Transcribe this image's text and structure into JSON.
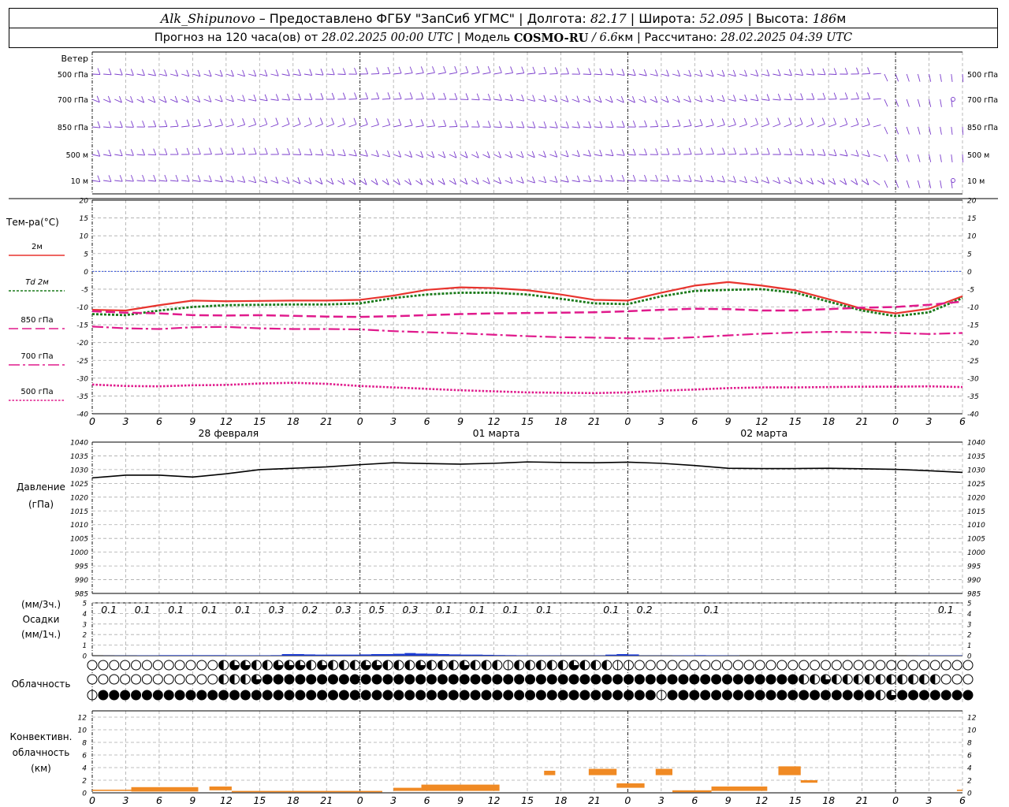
{
  "header": {
    "station": "Alk_Shipunovo",
    "provider": " – Предоставлено ФГБУ \"ЗапСиб УГМС\" | Долгота: ",
    "lon": "82.17",
    "lat_label": " | Широта: ",
    "lat": "52.095",
    "alt_label": " | Высота: ",
    "alt": "186",
    "alt_unit": "м",
    "forecast_prefix": "Прогноз на 120 часа(ов) от ",
    "base_time": "28.02.2025 00:00 UTC",
    "model_prefix": " | Модель ",
    "model": "COSMO-RU",
    "resolution": " / 6.6",
    "res_unit": "км",
    "calc_prefix": " | Рассчитано: ",
    "calc_time": "28.02.2025 04:39 UTC"
  },
  "chart_data": [
    {
      "type": "line",
      "panel": "wind",
      "ylabel": "Ветер",
      "levels": [
        "500 гПа",
        "700 гПа",
        "850 гПа",
        "500 м",
        "10  м"
      ],
      "calm_levels_at_end": [
        1,
        4
      ],
      "color": "#7a3ccc"
    },
    {
      "type": "line",
      "panel": "temperature",
      "ylabel": "Тем-ра(°C)",
      "ylim": [
        -40,
        20
      ],
      "yticks": [
        20,
        15,
        10,
        5,
        0,
        -5,
        -10,
        -15,
        -20,
        -25,
        -30,
        -35,
        -40
      ],
      "x_hours": [
        0,
        3,
        6,
        9,
        12,
        15,
        18,
        21,
        24,
        27,
        30,
        33,
        36,
        39,
        42,
        45,
        48,
        51,
        54,
        57,
        60,
        63,
        66,
        69,
        72,
        75,
        78
      ],
      "xtick_labels": [
        "0",
        "3",
        "6",
        "9",
        "12",
        "15",
        "18",
        "21",
        "0",
        "3",
        "6",
        "9",
        "12",
        "15",
        "18",
        "21",
        "0",
        "3",
        "6",
        "9",
        "12",
        "15",
        "18",
        "21",
        "0",
        "3",
        "6"
      ],
      "date_labels": [
        "28 февраля",
        "01 марта",
        "02 марта"
      ],
      "series": [
        {
          "name": "2м",
          "color": "#e8342e",
          "style": "solid",
          "values": [
            -10.8,
            -11,
            -9.5,
            -8.2,
            -8.4,
            -8.3,
            -8.2,
            -8.2,
            -8,
            -6.8,
            -5.2,
            -4.5,
            -4.7,
            -5.3,
            -6.5,
            -8,
            -8.2,
            -6,
            -4,
            -3,
            -4,
            -5.3,
            -7.8,
            -10.5,
            -11.8,
            -10.5,
            -7
          ]
        },
        {
          "name": "Td  2м",
          "color": "#1a7a1a",
          "style": "dotted",
          "values": [
            -12,
            -12.3,
            -11,
            -10,
            -9.5,
            -9.4,
            -9.3,
            -9.3,
            -9,
            -7.5,
            -6.5,
            -6,
            -6,
            -6.5,
            -7.7,
            -9,
            -9.2,
            -7,
            -5.5,
            -5.2,
            -5,
            -6,
            -8.5,
            -11,
            -12.6,
            -11.5,
            -7.5
          ]
        },
        {
          "name": "850 гПа",
          "color": "#e01a8c",
          "style": "dash",
          "values": [
            -11.2,
            -11.6,
            -11.8,
            -12.3,
            -12.4,
            -12.3,
            -12.5,
            -12.7,
            -12.8,
            -12.6,
            -12.3,
            -12,
            -11.8,
            -11.7,
            -11.6,
            -11.5,
            -11.2,
            -10.8,
            -10.5,
            -10.6,
            -11,
            -11,
            -10.6,
            -10.2,
            -10,
            -9.4,
            -8.5
          ]
        },
        {
          "name": "700 гПа",
          "color": "#e01a8c",
          "style": "dashdot",
          "values": [
            -15.5,
            -16,
            -16.2,
            -15.7,
            -15.6,
            -16,
            -16.2,
            -16.2,
            -16.3,
            -16.8,
            -17.1,
            -17.4,
            -17.8,
            -18.2,
            -18.5,
            -18.6,
            -18.8,
            -18.9,
            -18.5,
            -18,
            -17.5,
            -17.2,
            -17,
            -17.1,
            -17.3,
            -17.6,
            -17.3
          ]
        },
        {
          "name": "500 гПа",
          "color": "#e01a8c",
          "style": "dot",
          "values": [
            -31.8,
            -32.2,
            -32.3,
            -32,
            -31.9,
            -31.5,
            -31.3,
            -31.6,
            -32.2,
            -32.6,
            -33,
            -33.4,
            -33.7,
            -34,
            -34.1,
            -34.2,
            -34,
            -33.5,
            -33.2,
            -32.8,
            -32.6,
            -32.6,
            -32.5,
            -32.4,
            -32.4,
            -32.3,
            -32.5
          ]
        }
      ]
    },
    {
      "type": "line",
      "panel": "pressure",
      "ylabel": "Давление",
      "ylabel2": "(гПа)",
      "ylim": [
        985,
        1040
      ],
      "yticks": [
        1040,
        1035,
        1030,
        1025,
        1020,
        1015,
        1010,
        1005,
        1000,
        995,
        990,
        985
      ],
      "series": [
        {
          "name": "pressure",
          "color": "#000000",
          "values": [
            1027,
            1028,
            1028,
            1027.3,
            1028.5,
            1030,
            1030.5,
            1031,
            1031.8,
            1032.5,
            1032.2,
            1032,
            1032.3,
            1032.8,
            1032.6,
            1032.5,
            1032.7,
            1032.3,
            1031.5,
            1030.5,
            1030.4,
            1030.4,
            1030.5,
            1030.3,
            1030.1,
            1029.6,
            1029
          ]
        }
      ]
    },
    {
      "type": "bar",
      "panel": "precipitation",
      "ylabel": "(мм/3ч.)",
      "ylabel2": "Осадки",
      "ylabel3": "(мм/1ч.)",
      "ylim": [
        0,
        5
      ],
      "yticks": [
        "5",
        "4",
        "3",
        "2",
        "1",
        "0",
        "5",
        "4",
        "3",
        "2",
        "1",
        "0"
      ],
      "labels_3h": [
        {
          "x": 0,
          "text": "0.1"
        },
        {
          "x": 3,
          "text": "0.1"
        },
        {
          "x": 6,
          "text": "0.1"
        },
        {
          "x": 9,
          "text": "0.1"
        },
        {
          "x": 12,
          "text": "0.1"
        },
        {
          "x": 15,
          "text": "0.3"
        },
        {
          "x": 18,
          "text": "0.2"
        },
        {
          "x": 21,
          "text": "0.3"
        },
        {
          "x": 24,
          "text": "0.5"
        },
        {
          "x": 27,
          "text": "0.3"
        },
        {
          "x": 30,
          "text": "0.1"
        },
        {
          "x": 33,
          "text": "0.1"
        },
        {
          "x": 36,
          "text": "0.1"
        },
        {
          "x": 39,
          "text": "0.1"
        },
        {
          "x": 45,
          "text": "0.1"
        },
        {
          "x": 48,
          "text": "0.2"
        },
        {
          "x": 54,
          "text": "0.1"
        },
        {
          "x": 75,
          "text": "0.1"
        }
      ],
      "hourly_mm": [
        0,
        0.01,
        0.02,
        0.02,
        0.03,
        0.03,
        0.05,
        0.05,
        0.05,
        0.05,
        0.05,
        0.05,
        0.04,
        0.04,
        0.04,
        0.04,
        0.05,
        0.15,
        0.15,
        0.12,
        0.1,
        0.1,
        0.1,
        0.1,
        0.12,
        0.15,
        0.15,
        0.18,
        0.25,
        0.2,
        0.18,
        0.15,
        0.12,
        0.1,
        0.1,
        0.08,
        0.06,
        0.05,
        0.04,
        0.03,
        0.03,
        0.03,
        0.02,
        0.02,
        0.02,
        0.03,
        0.1,
        0.15,
        0.12,
        0.02,
        0.02,
        0.02,
        0.03,
        0.04,
        0.05,
        0.04,
        0.03,
        0.02,
        0,
        0,
        0,
        0,
        0,
        0,
        0,
        0,
        0,
        0,
        0,
        0,
        0,
        0,
        0,
        0.01,
        0.02,
        0.03,
        0.03,
        0.03
      ],
      "color": "#1a3ad1"
    },
    {
      "type": "table",
      "panel": "clouds",
      "ylabel": "Облачность",
      "rows": [
        [
          0,
          0,
          0,
          0,
          0,
          0,
          0,
          0,
          0,
          0,
          0,
          0,
          2,
          3,
          3,
          2,
          2,
          3,
          3,
          3,
          2,
          3,
          2,
          2,
          2,
          3,
          3,
          2,
          2,
          2,
          3,
          2,
          2,
          2,
          3,
          2,
          2,
          2,
          1,
          2,
          2,
          2,
          2,
          2,
          3,
          2,
          2,
          2,
          1,
          1,
          0,
          0,
          0,
          0,
          0,
          0,
          0,
          0,
          0,
          0,
          0,
          0,
          0,
          0,
          0,
          0,
          0,
          0,
          0,
          0,
          0,
          0,
          0,
          0,
          0,
          0,
          0,
          0,
          0,
          0,
          0
        ],
        [
          0,
          0,
          0,
          0,
          0,
          0,
          0,
          0,
          0,
          0,
          0,
          0,
          2,
          2,
          2,
          3,
          4,
          4,
          4,
          4,
          4,
          4,
          4,
          4,
          4,
          4,
          4,
          4,
          4,
          4,
          4,
          4,
          4,
          4,
          4,
          4,
          4,
          4,
          4,
          4,
          4,
          4,
          4,
          4,
          4,
          4,
          4,
          4,
          4,
          4,
          4,
          4,
          4,
          4,
          4,
          4,
          4,
          4,
          4,
          4,
          4,
          4,
          4,
          4,
          4,
          2,
          2,
          3,
          2,
          2,
          2,
          2,
          2,
          2,
          2,
          2,
          2,
          2,
          0,
          0,
          0
        ],
        [
          1,
          4,
          4,
          4,
          4,
          4,
          4,
          4,
          4,
          4,
          4,
          4,
          4,
          4,
          4,
          4,
          4,
          4,
          4,
          4,
          4,
          4,
          4,
          4,
          4,
          4,
          4,
          4,
          4,
          4,
          4,
          4,
          4,
          4,
          4,
          4,
          4,
          4,
          4,
          4,
          4,
          4,
          4,
          4,
          4,
          4,
          4,
          4,
          4,
          4,
          4,
          4,
          1,
          4,
          4,
          4,
          4,
          4,
          4,
          4,
          4,
          4,
          4,
          4,
          4,
          4,
          4,
          4,
          4,
          4,
          4,
          4,
          2,
          3,
          4,
          4,
          4,
          4,
          4,
          4,
          4
        ]
      ]
    },
    {
      "type": "bar",
      "panel": "convective",
      "ylabel": "Конвективн.",
      "ylabel2": "облачность",
      "ylabel3": "(км)",
      "ylim": [
        0,
        13
      ],
      "yticks": [
        12,
        10,
        8,
        6,
        4,
        2,
        0
      ],
      "color": "#f08a24",
      "segments": [
        {
          "x0": 0,
          "x1": 6,
          "bot": 0.3,
          "top": 0.5
        },
        {
          "x0": 3.5,
          "x1": 9.5,
          "bot": 0.2,
          "top": 0.9
        },
        {
          "x0": 10.5,
          "x1": 12.5,
          "bot": 0.4,
          "top": 1.0
        },
        {
          "x0": 12.5,
          "x1": 26,
          "bot": 0.1,
          "top": 0.3
        },
        {
          "x0": 27,
          "x1": 29.5,
          "bot": 0.3,
          "top": 0.8
        },
        {
          "x0": 29.5,
          "x1": 36.5,
          "bot": 0.3,
          "top": 1.3
        },
        {
          "x0": 40.5,
          "x1": 41.5,
          "bot": 2.8,
          "top": 3.5
        },
        {
          "x0": 44.5,
          "x1": 47,
          "bot": 2.8,
          "top": 3.8
        },
        {
          "x0": 47,
          "x1": 49.5,
          "bot": 0.8,
          "top": 1.5
        },
        {
          "x0": 50.5,
          "x1": 52,
          "bot": 2.8,
          "top": 3.8
        },
        {
          "x0": 52,
          "x1": 55.5,
          "bot": 0.1,
          "top": 0.4
        },
        {
          "x0": 55.5,
          "x1": 60.5,
          "bot": 0.3,
          "top": 1.0
        },
        {
          "x0": 61.5,
          "x1": 63.5,
          "bot": 2.8,
          "top": 4.2
        },
        {
          "x0": 63.5,
          "x1": 65,
          "bot": 1.6,
          "top": 2.0
        },
        {
          "x0": 77.5,
          "x1": 78,
          "bot": 0.3,
          "top": 0.5
        }
      ]
    }
  ]
}
